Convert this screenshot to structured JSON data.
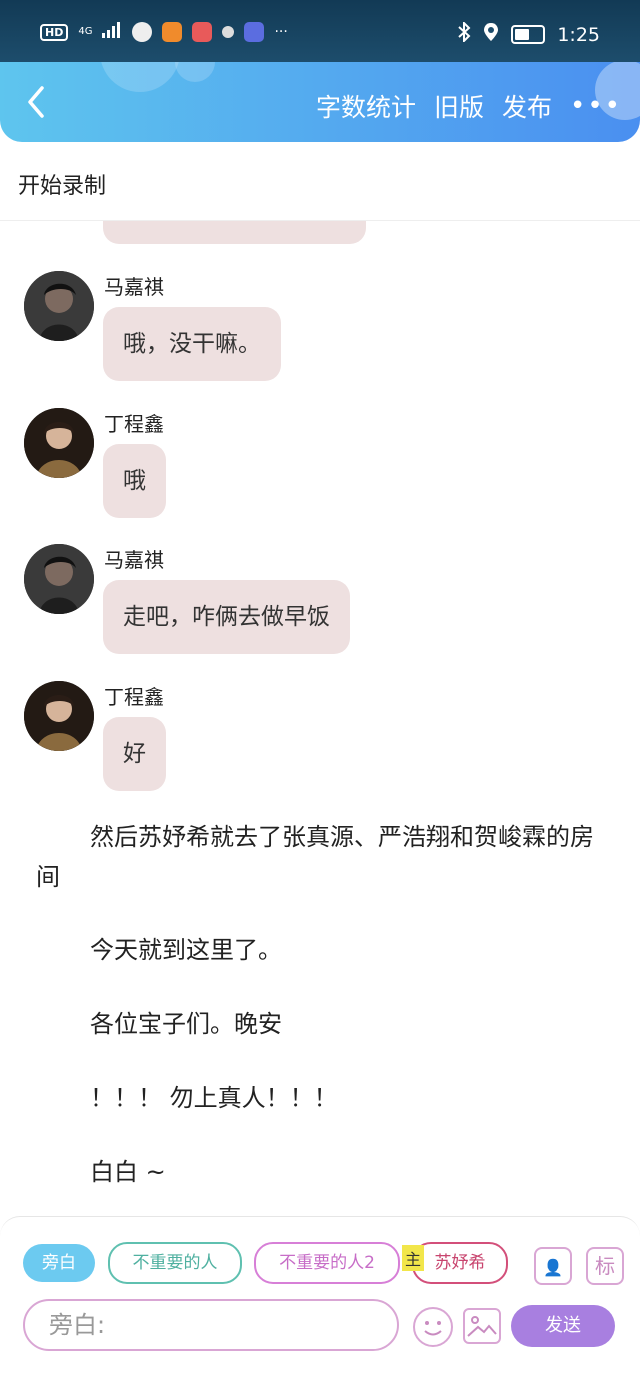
{
  "status_bar": {
    "hd": "HD",
    "net": "4G",
    "more": "···",
    "time": "1:25"
  },
  "header": {
    "actions": [
      "字数统计",
      "旧版",
      "发布"
    ],
    "more": "•••"
  },
  "record_bar": {
    "label": "开始录制"
  },
  "messages": [
    {
      "name": "马嘉祺",
      "text": "哦，没干嘛。"
    },
    {
      "name": "丁程鑫",
      "text": "哦"
    },
    {
      "name": "马嘉祺",
      "text": "走吧，咋俩去做早饭"
    },
    {
      "name": "丁程鑫",
      "text": "好"
    }
  ],
  "narration": [
    "然后苏妤希就去了张真源、严浩翔和贺峻霖的房间",
    "今天就到这里了。",
    "各位宝子们。晚安",
    "！！！ 勿上真人！！！",
    "白白 ~"
  ],
  "roles": {
    "narrator": "旁白",
    "minor1": "不重要的人",
    "minor2": "不重要的人2",
    "main_tag": "主",
    "main": "苏妤希"
  },
  "tool_buttons": {
    "character": "👤",
    "mark": "标"
  },
  "input": {
    "placeholder": "旁白:"
  },
  "send_label": "发送",
  "colors": {
    "header_start": "#5ec5ee",
    "header_end": "#4a8ff0",
    "bubble": "#eee0e0",
    "send": "#a87fe0",
    "narrator_chip": "#6ccaf0",
    "minor1_border": "#5fc0b0",
    "minor2_border": "#d77fd7",
    "main_border": "#d34f7a"
  }
}
